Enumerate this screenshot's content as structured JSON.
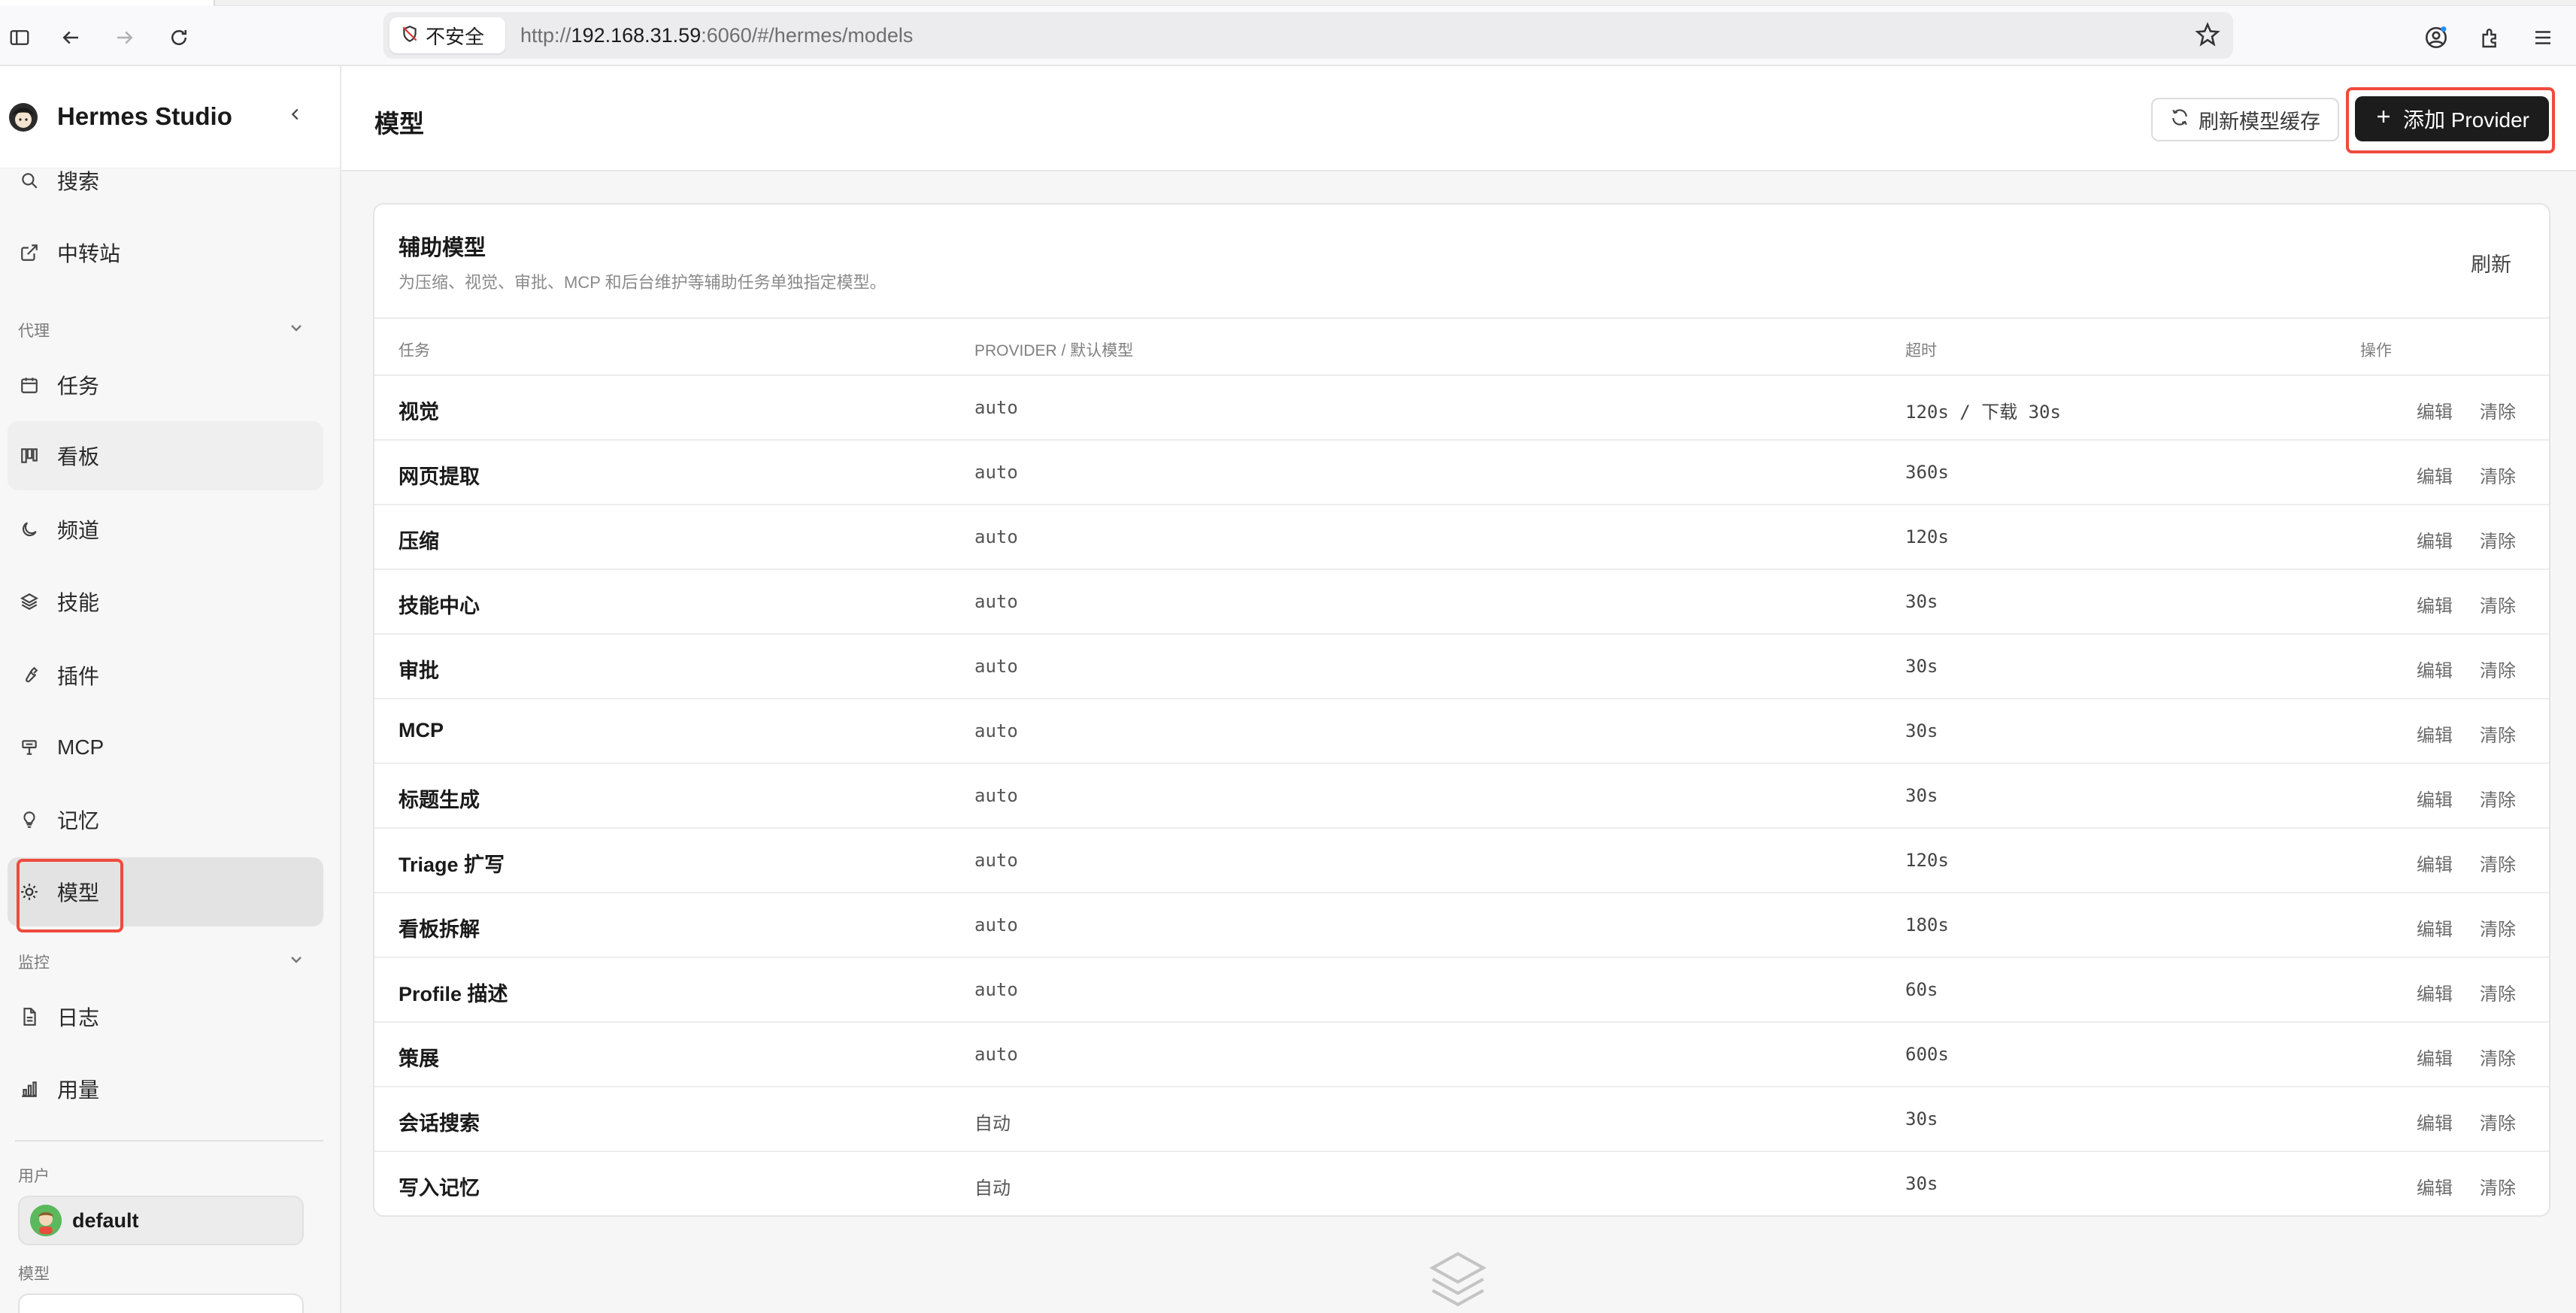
{
  "browser": {
    "security_label": "不安全",
    "url_prefix": "http://",
    "url_host": "192.168.31.59",
    "url_rest": ":6060/#/hermes/models"
  },
  "sidebar": {
    "app_name": "Hermes Studio",
    "top_items": [
      {
        "label": "搜索",
        "icon": "search-icon"
      },
      {
        "label": "中转站",
        "icon": "external-link-icon"
      }
    ],
    "section_agent": "代理",
    "agent_items": [
      {
        "label": "任务",
        "icon": "calendar-icon"
      },
      {
        "label": "看板",
        "icon": "kanban-icon"
      },
      {
        "label": "频道",
        "icon": "moon-icon"
      },
      {
        "label": "技能",
        "icon": "layers-icon"
      },
      {
        "label": "插件",
        "icon": "wrench-icon"
      },
      {
        "label": "MCP",
        "icon": "plug-icon"
      },
      {
        "label": "记忆",
        "icon": "lightbulb-icon"
      },
      {
        "label": "模型",
        "icon": "sun-icon"
      }
    ],
    "section_monitor": "监控",
    "monitor_items": [
      {
        "label": "日志",
        "icon": "file-icon"
      },
      {
        "label": "用量",
        "icon": "bar-chart-icon"
      }
    ],
    "section_user": "用户",
    "user_name": "default",
    "section_model": "模型"
  },
  "header": {
    "title": "模型",
    "refresh_cache_label": "刷新模型缓存",
    "add_provider_label": "添加 Provider"
  },
  "aux_models": {
    "title": "辅助模型",
    "subtitle": "为压缩、视觉、审批、MCP 和后台维护等辅助任务单独指定模型。",
    "refresh_label": "刷新",
    "columns": {
      "task": "任务",
      "provider": "PROVIDER / 默认模型",
      "timeout": "超时",
      "actions": "操作"
    },
    "edit_label": "编辑",
    "clear_label": "清除",
    "rows": [
      {
        "task": "视觉",
        "provider": "auto",
        "timeout": "120s / 下载 30s"
      },
      {
        "task": "网页提取",
        "provider": "auto",
        "timeout": "360s"
      },
      {
        "task": "压缩",
        "provider": "auto",
        "timeout": "120s"
      },
      {
        "task": "技能中心",
        "provider": "auto",
        "timeout": "30s"
      },
      {
        "task": "审批",
        "provider": "auto",
        "timeout": "30s"
      },
      {
        "task": "MCP",
        "provider": "auto",
        "timeout": "30s"
      },
      {
        "task": "标题生成",
        "provider": "auto",
        "timeout": "30s"
      },
      {
        "task": "Triage 扩写",
        "provider": "auto",
        "timeout": "120s"
      },
      {
        "task": "看板拆解",
        "provider": "auto",
        "timeout": "180s"
      },
      {
        "task": "Profile 描述",
        "provider": "auto",
        "timeout": "60s"
      },
      {
        "task": "策展",
        "provider": "auto",
        "timeout": "600s"
      },
      {
        "task": "会话搜索",
        "provider": "自动",
        "timeout": "30s"
      },
      {
        "task": "写入记忆",
        "provider": "自动",
        "timeout": "30s"
      }
    ]
  }
}
